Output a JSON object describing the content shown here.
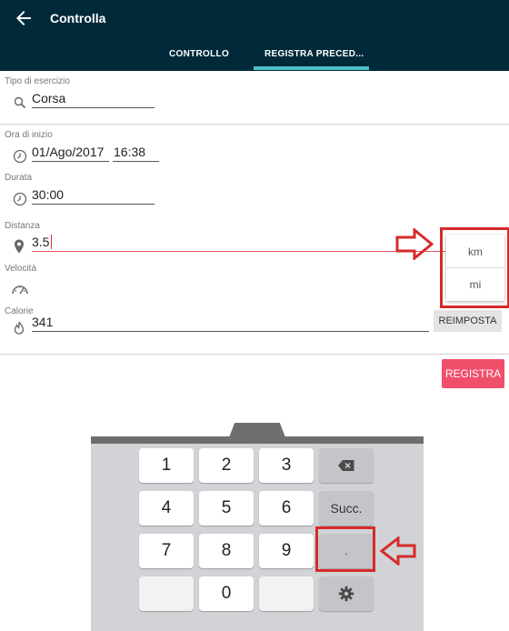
{
  "header": {
    "title": "Controlla",
    "tabs": [
      {
        "label": "CONTROLLO",
        "active": false
      },
      {
        "label": "REGISTRA PRECED...",
        "active": true
      }
    ]
  },
  "form": {
    "exercise_type": {
      "label": "Tipo di esercizio",
      "value": "Corsa"
    },
    "start_time": {
      "label": "Ora di inizio",
      "date": "01/Ago/2017",
      "time": "16:38"
    },
    "duration": {
      "label": "Durata",
      "value": "30:00"
    },
    "distance": {
      "label": "Distanza",
      "value": "3.5"
    },
    "speed": {
      "label": "Velocità"
    },
    "calories": {
      "label": "Calorie",
      "value": "341"
    }
  },
  "unit_dropdown": {
    "options": [
      "km",
      "mi"
    ]
  },
  "buttons": {
    "reset": "REIMPOSTA",
    "register": "REGISTRA"
  },
  "keyboard": {
    "rows": [
      [
        "1",
        "2",
        "3",
        "backspace"
      ],
      [
        "4",
        "5",
        "6",
        "Succ."
      ],
      [
        "7",
        "8",
        "9",
        "."
      ],
      [
        "",
        "0",
        "",
        "settings"
      ]
    ]
  },
  "colors": {
    "header_bg": "#002a3a",
    "tab_indicator": "#4fc3c8",
    "accent_pink": "#f04f6a",
    "annotation_red": "#d62a2a"
  }
}
